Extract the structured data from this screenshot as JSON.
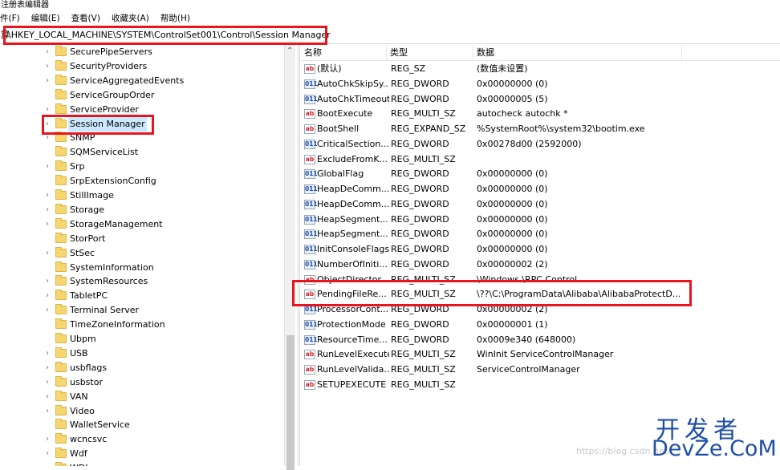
{
  "window": {
    "title": "注册表编辑器"
  },
  "menu": [
    {
      "label": "件(F)"
    },
    {
      "label": "编辑(E)"
    },
    {
      "label": "查看(V)"
    },
    {
      "label": "收藏夹(A)"
    },
    {
      "label": "帮助(H)"
    }
  ],
  "address": {
    "prefix": "算",
    "path": "\\HKEY_LOCAL_MACHINE\\SYSTEM\\ControlSet001\\Control\\Session Manager"
  },
  "tree": {
    "items": [
      {
        "label": "SecurePipeServers",
        "expander": "›"
      },
      {
        "label": "SecurityProviders",
        "expander": "›"
      },
      {
        "label": "ServiceAggregatedEvents",
        "expander": "›"
      },
      {
        "label": "ServiceGroupOrder",
        "expander": ""
      },
      {
        "label": "ServiceProvider",
        "expander": "›"
      },
      {
        "label": "Session Manager",
        "expander": "›",
        "selected": true
      },
      {
        "label": "SNMP",
        "expander": "›"
      },
      {
        "label": "SQMServiceList",
        "expander": ""
      },
      {
        "label": "Srp",
        "expander": "›"
      },
      {
        "label": "SrpExtensionConfig",
        "expander": ""
      },
      {
        "label": "StillImage",
        "expander": "›"
      },
      {
        "label": "Storage",
        "expander": "›"
      },
      {
        "label": "StorageManagement",
        "expander": "›"
      },
      {
        "label": "StorPort",
        "expander": ""
      },
      {
        "label": "StSec",
        "expander": "›"
      },
      {
        "label": "SystemInformation",
        "expander": ""
      },
      {
        "label": "SystemResources",
        "expander": "›"
      },
      {
        "label": "TabletPC",
        "expander": "›"
      },
      {
        "label": "Terminal Server",
        "expander": "›"
      },
      {
        "label": "TimeZoneInformation",
        "expander": ""
      },
      {
        "label": "Ubpm",
        "expander": ""
      },
      {
        "label": "USB",
        "expander": "›"
      },
      {
        "label": "usbflags",
        "expander": "›"
      },
      {
        "label": "usbstor",
        "expander": "›"
      },
      {
        "label": "VAN",
        "expander": "›"
      },
      {
        "label": "Video",
        "expander": "›"
      },
      {
        "label": "WalletService",
        "expander": ""
      },
      {
        "label": "wcncsvc",
        "expander": "›"
      },
      {
        "label": "Wdf",
        "expander": "›"
      },
      {
        "label": "WDI",
        "expander": "›"
      }
    ]
  },
  "list": {
    "headers": {
      "name": "名称",
      "type": "类型",
      "data": "数据"
    },
    "rows": [
      {
        "icon": "ab",
        "name": "(默认)",
        "type": "REG_SZ",
        "data": "(数值未设置)"
      },
      {
        "icon": "bin",
        "name": "AutoChkSkipSy...",
        "type": "REG_DWORD",
        "data": "0x00000000 (0)"
      },
      {
        "icon": "bin",
        "name": "AutoChkTimeout",
        "type": "REG_DWORD",
        "data": "0x00000005 (5)"
      },
      {
        "icon": "ab",
        "name": "BootExecute",
        "type": "REG_MULTI_SZ",
        "data": "autocheck autochk *"
      },
      {
        "icon": "ab",
        "name": "BootShell",
        "type": "REG_EXPAND_SZ",
        "data": "%SystemRoot%\\system32\\bootim.exe"
      },
      {
        "icon": "bin",
        "name": "CriticalSection...",
        "type": "REG_DWORD",
        "data": "0x00278d00 (2592000)"
      },
      {
        "icon": "ab",
        "name": "ExcludeFromK...",
        "type": "REG_MULTI_SZ",
        "data": ""
      },
      {
        "icon": "bin",
        "name": "GlobalFlag",
        "type": "REG_DWORD",
        "data": "0x00000000 (0)"
      },
      {
        "icon": "bin",
        "name": "HeapDeComm...",
        "type": "REG_DWORD",
        "data": "0x00000000 (0)"
      },
      {
        "icon": "bin",
        "name": "HeapDeComm...",
        "type": "REG_DWORD",
        "data": "0x00000000 (0)"
      },
      {
        "icon": "bin",
        "name": "HeapSegment...",
        "type": "REG_DWORD",
        "data": "0x00000000 (0)"
      },
      {
        "icon": "bin",
        "name": "HeapSegment...",
        "type": "REG_DWORD",
        "data": "0x00000000 (0)"
      },
      {
        "icon": "bin",
        "name": "InitConsoleFlags",
        "type": "REG_DWORD",
        "data": "0x00000000 (0)"
      },
      {
        "icon": "bin",
        "name": "NumberOfIniti...",
        "type": "REG_DWORD",
        "data": "0x00000002 (2)"
      },
      {
        "icon": "ab",
        "name": "ObjectDirector...",
        "type": "REG_MULTI_SZ",
        "data": "\\Windows \\RPC Control"
      },
      {
        "icon": "ab",
        "name": "PendingFileRe...",
        "type": "REG_MULTI_SZ",
        "data": "\\??\\C:\\ProgramData\\Alibaba\\AlibabaProtectD..."
      },
      {
        "icon": "bin",
        "name": "ProcessorCont...",
        "type": "REG_DWORD",
        "data": "0x00000002 (2)"
      },
      {
        "icon": "bin",
        "name": "ProtectionMode",
        "type": "REG_DWORD",
        "data": "0x00000001 (1)"
      },
      {
        "icon": "bin",
        "name": "ResourceTime...",
        "type": "REG_DWORD",
        "data": "0x0009e340 (648000)"
      },
      {
        "icon": "ab",
        "name": "RunLevelExecute",
        "type": "REG_MULTI_SZ",
        "data": "WinInit ServiceControlManager"
      },
      {
        "icon": "ab",
        "name": "RunLevelValida...",
        "type": "REG_MULTI_SZ",
        "data": "ServiceControlManager"
      },
      {
        "icon": "ab",
        "name": "SETUPEXECUTE",
        "type": "REG_MULTI_SZ",
        "data": ""
      }
    ]
  },
  "watermark": "https://blog.csdn.net/...",
  "logo": {
    "cn": "开发者",
    "en": "DevZe.CoM"
  },
  "colors": {
    "highlight": "#e8141e",
    "logo": "#1f4ea8",
    "selection": "#cce8ff"
  }
}
